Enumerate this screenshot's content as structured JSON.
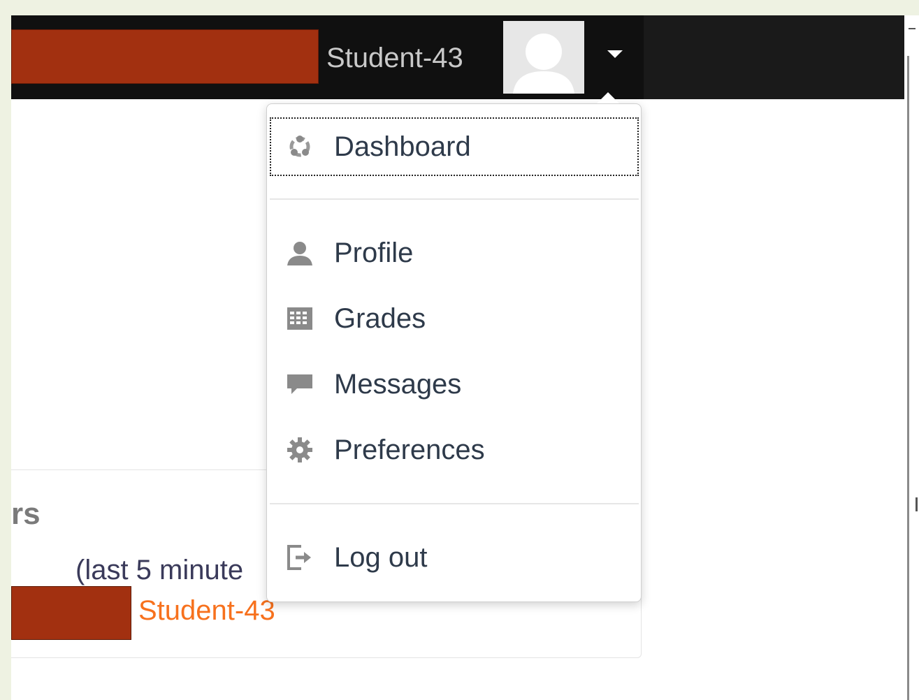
{
  "header": {
    "username": "Student-43"
  },
  "user_menu": {
    "items": [
      {
        "label": "Dashboard",
        "icon": "dashboard-icon"
      },
      {
        "label": "Profile",
        "icon": "user-icon"
      },
      {
        "label": "Grades",
        "icon": "grades-table-icon"
      },
      {
        "label": "Messages",
        "icon": "message-bubble-icon"
      },
      {
        "label": "Preferences",
        "icon": "gear-icon"
      },
      {
        "label": "Log out",
        "icon": "logout-icon"
      }
    ]
  },
  "online_users_block": {
    "title_fragment": "rs",
    "note": "(last 5 minute",
    "user": "Student-43"
  },
  "colors": {
    "navbar": "#101010",
    "redaction": "#a23010",
    "link_orange": "#f7711d"
  }
}
